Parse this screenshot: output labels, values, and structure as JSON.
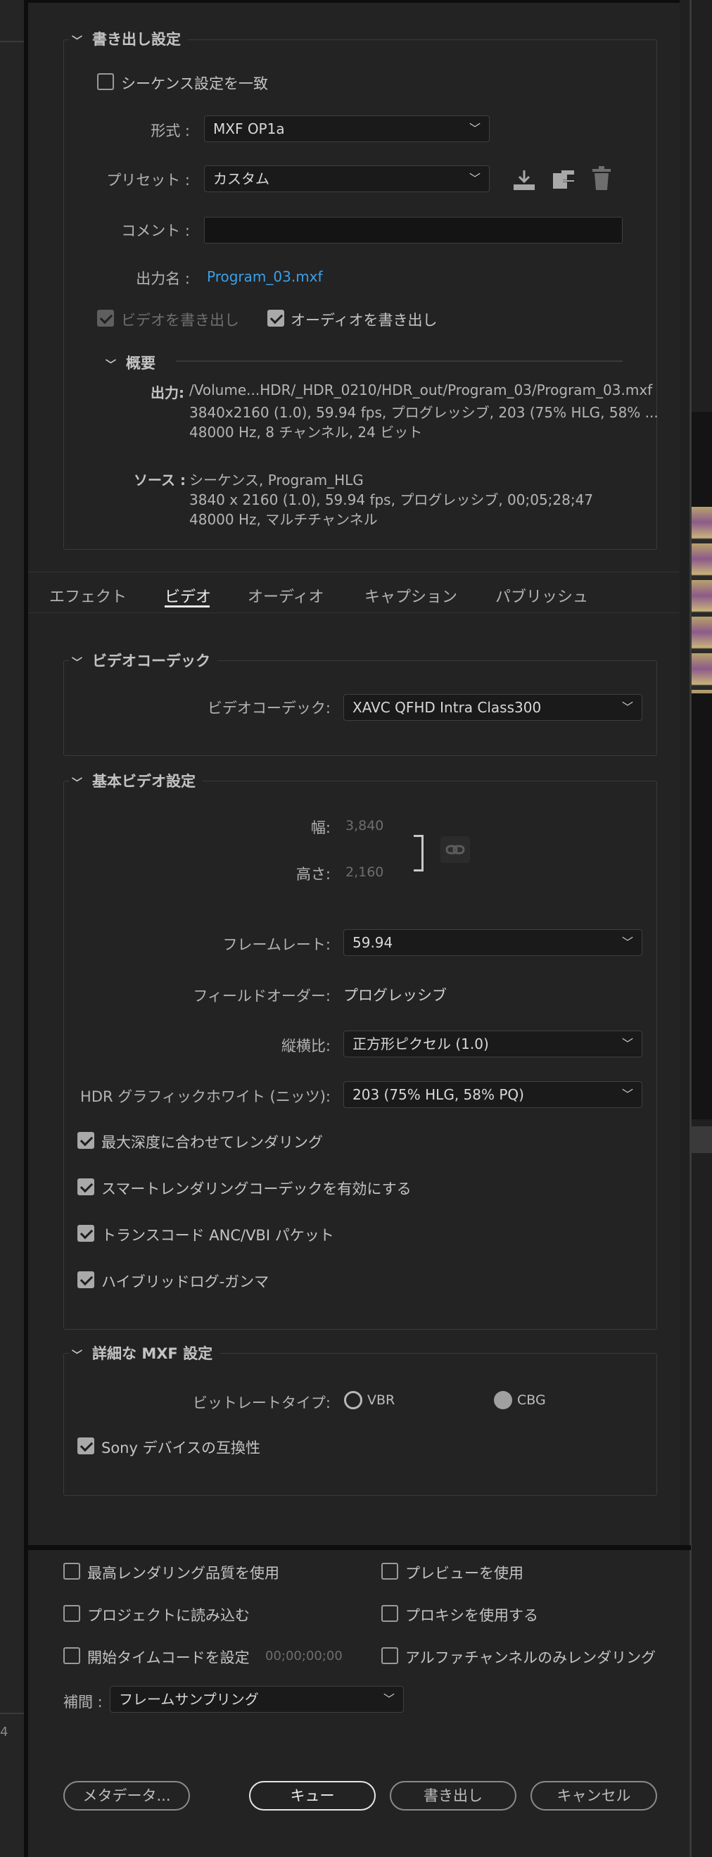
{
  "export_settings": {
    "section_title": "書き出し設定",
    "match_sequence_label": "シーケンス設定を一致",
    "format_label": "形式 :",
    "format_value": "MXF OP1a",
    "preset_label": "プリセット :",
    "preset_value": "カスタム",
    "comment_label": "コメント :",
    "comment_value": "",
    "output_name_label": "出力名 :",
    "output_name_value": "Program_03.mxf",
    "export_video_label": "ビデオを書き出し",
    "export_audio_label": "オーディオを書き出し"
  },
  "summary": {
    "title": "概要",
    "output_label": "出力:",
    "output_lines": [
      "/Volume...HDR/_HDR_0210/HDR_out/Program_03/Program_03.mxf",
      "3840x2160 (1.0), 59.94 fps, プログレッシブ, 203 (75% HLG, 58% ...",
      "48000 Hz, 8 チャンネル, 24 ビット"
    ],
    "source_label": "ソース :",
    "source_lines": [
      "シーケンス, Program_HLG",
      "3840 x 2160 (1.0), 59.94 fps, プログレッシブ, 00;05;28;47",
      "48000 Hz, マルチチャンネル"
    ]
  },
  "tabs": [
    "エフェクト",
    "ビデオ",
    "オーディオ",
    "キャプション",
    "パブリッシュ"
  ],
  "video_codec": {
    "section_title": "ビデオコーデック",
    "codec_label": "ビデオコーデック:",
    "codec_value": "XAVC QFHD Intra Class300"
  },
  "basic_video": {
    "section_title": "基本ビデオ設定",
    "width_label": "幅:",
    "width_value": "3,840",
    "height_label": "高さ:",
    "height_value": "2,160",
    "frame_rate_label": "フレームレート:",
    "frame_rate_value": "59.94",
    "field_order_label": "フィールドオーダー:",
    "field_order_value": "プログレッシブ",
    "aspect_label": "縦横比:",
    "aspect_value": "正方形ピクセル (1.0)",
    "hdr_white_label": "HDR グラフィックホワイト (ニッツ):",
    "hdr_white_value": "203 (75% HLG, 58% PQ)",
    "render_max_depth_label": "最大深度に合わせてレンダリング",
    "smart_render_label": "スマートレンダリングコーデックを有効にする",
    "transcode_anc_label": "トランスコード ANC/VBI パケット",
    "hybrid_log_gamma_label": "ハイブリッドログ-ガンマ"
  },
  "mxf_settings": {
    "section_title": "詳細な MXF 設定",
    "bitrate_type_label": "ビットレートタイプ:",
    "vbr_label": "VBR",
    "cbg_label": "CBG",
    "sony_compat_label": "Sony デバイスの互換性"
  },
  "bottom_options": {
    "max_render_quality_label": "最高レンダリング品質を使用",
    "use_previews_label": "プレビューを使用",
    "import_into_project_label": "プロジェクトに読み込む",
    "use_proxies_label": "プロキシを使用する",
    "set_start_timecode_label": "開始タイムコードを設定",
    "start_timecode_value": "00;00;00;00",
    "render_alpha_only_label": "アルファチャンネルのみレンダリング",
    "interpolation_label": "補間 :",
    "interpolation_value": "フレームサンプリング"
  },
  "buttons": {
    "metadata": "メタデータ...",
    "queue": "キュー",
    "export": "書き出し",
    "cancel": "キャンセル"
  },
  "background_edge_text": "4"
}
